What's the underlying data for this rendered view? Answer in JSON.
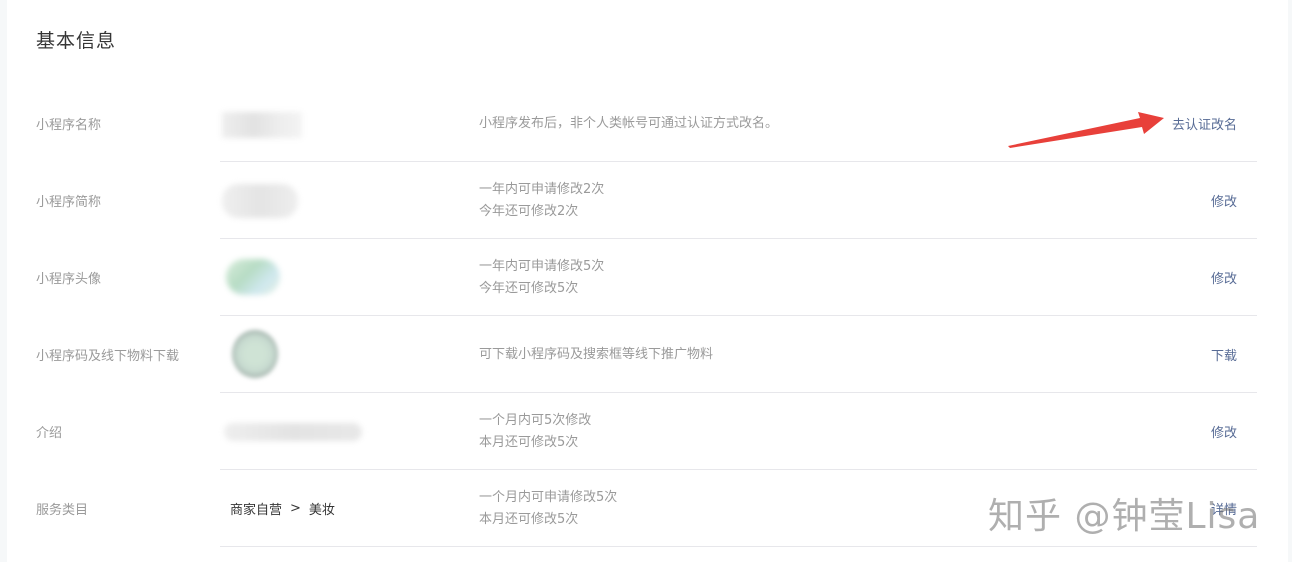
{
  "section": {
    "title": "基本信息"
  },
  "rows": [
    {
      "label": "小程序名称",
      "desc": [
        "小程序发布后，非个人类帐号可通过认证方式改名。"
      ],
      "action": "去认证改名"
    },
    {
      "label": "小程序简称",
      "desc": [
        "一年内可申请修改2次",
        "今年还可修改2次"
      ],
      "action": "修改"
    },
    {
      "label": "小程序头像",
      "desc": [
        "一年内可申请修改5次",
        "今年还可修改5次"
      ],
      "action": "修改"
    },
    {
      "label": "小程序码及线下物料下载",
      "desc": [
        "可下载小程序码及搜索框等线下推广物料"
      ],
      "action": "下载"
    },
    {
      "label": "介绍",
      "desc": [
        "一个月内可5次修改",
        "本月还可修改5次"
      ],
      "action": "修改"
    },
    {
      "label": "服务类目",
      "desc": [
        "一个月内可申请修改5次",
        "本月还可修改5次"
      ],
      "action": "详情"
    }
  ],
  "category": {
    "primary": "商家自营",
    "separator": ">",
    "secondary": "美妆"
  },
  "watermark": "知乎 @钟莹Lisa",
  "colors": {
    "link": "#576b95",
    "arrow": "#e8403a",
    "muted": "#9a9a9a"
  }
}
